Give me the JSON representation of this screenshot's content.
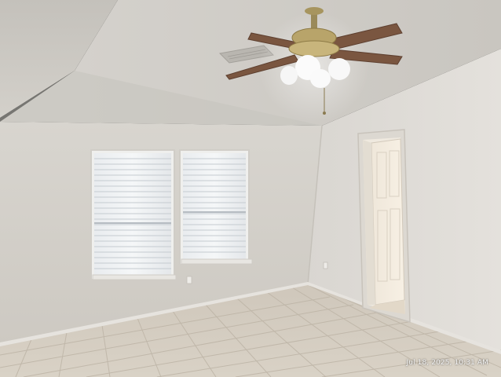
{
  "photo": {
    "scene": "empty room with ceiling fan, two blinded windows and open doorway",
    "timestamp": "Jul 18, 2025, 10:31 AM"
  }
}
